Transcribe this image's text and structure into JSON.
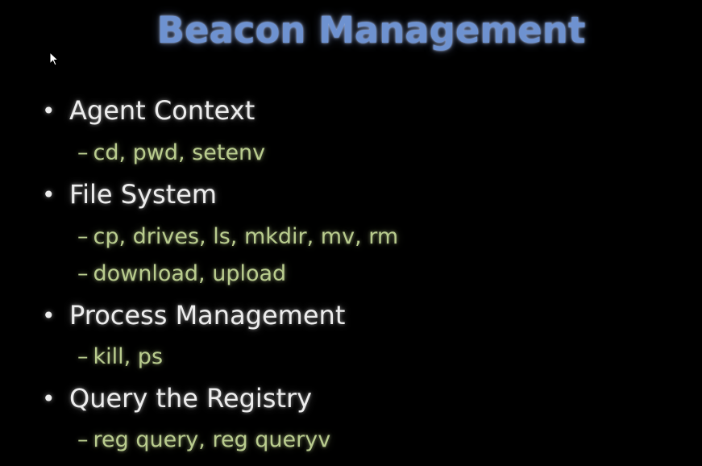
{
  "slide": {
    "title": "Beacon Management",
    "bullets": [
      {
        "label": "Agent Context",
        "subitems": [
          "cd, pwd, setenv"
        ]
      },
      {
        "label": "File System",
        "subitems": [
          "cp, drives, ls, mkdir, mv, rm",
          "download, upload"
        ]
      },
      {
        "label": "Process Management",
        "subitems": [
          "kill, ps"
        ]
      },
      {
        "label": "Query the Registry",
        "subitems": [
          "reg query, reg queryv"
        ]
      }
    ],
    "bullet_glyph": "•",
    "dash_glyph": "–",
    "colors": {
      "background": "#000000",
      "title": "#6E92D0",
      "bullet_text": "#EDEDED",
      "subitem_text": "#B9CC8E"
    }
  }
}
